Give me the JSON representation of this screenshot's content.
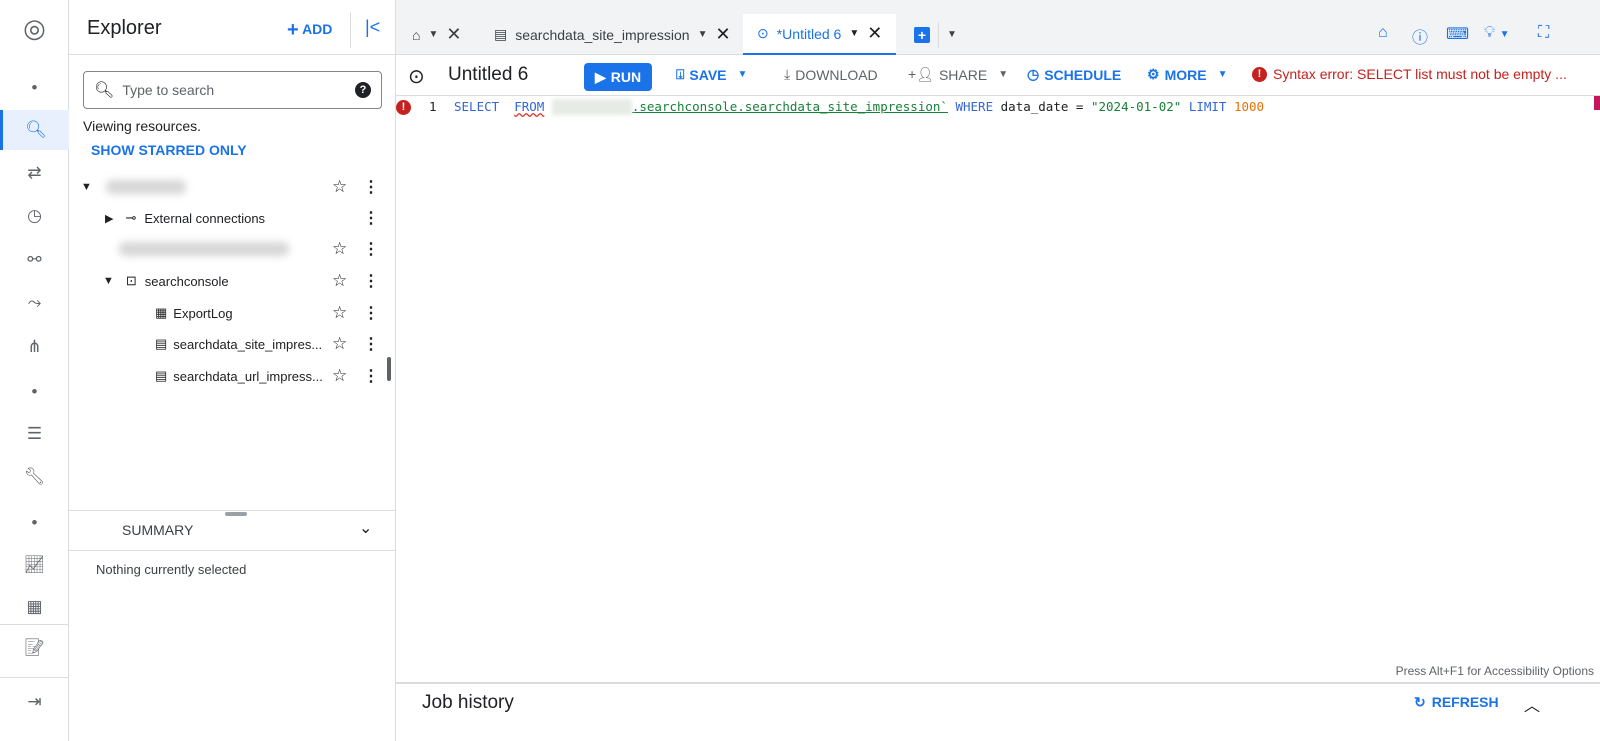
{
  "rail": {
    "items": [
      "dot",
      "search",
      "transfers",
      "scheduled",
      "analytics-hub",
      "dataflow",
      "graph",
      "dot",
      "list",
      "wrench",
      "dot",
      "monitoring",
      "dashboard",
      "release-notes",
      "expand"
    ]
  },
  "explorer": {
    "title": "Explorer",
    "add_label": "ADD",
    "search_placeholder": "Type to search",
    "viewing": "Viewing resources.",
    "show_starred": "SHOW STARRED ONLY",
    "tree": {
      "external": "External connections",
      "dataset": "searchconsole",
      "tables": [
        "ExportLog",
        "searchdata_site_impres...",
        "searchdata_url_impress..."
      ]
    },
    "summary": "SUMMARY",
    "nothing_selected": "Nothing currently selected"
  },
  "tabs": [
    {
      "label": "searchdata_site_impression"
    },
    {
      "label": "*Untitled 6"
    }
  ],
  "toolbar": {
    "title": "Untitled 6",
    "run": "RUN",
    "save": "SAVE",
    "download": "DOWNLOAD",
    "share": "SHARE",
    "schedule": "SCHEDULE",
    "more": "MORE",
    "error": "Syntax error: SELECT list must not be empty ..."
  },
  "editor": {
    "line_number": "1",
    "kw_select": "SELECT",
    "kw_from": "FROM",
    "table": ".searchconsole.searchdata_site_impression`",
    "kw_where": "WHERE",
    "col": "data_date =",
    "date": "\"2024-01-02\"",
    "kw_limit": "LIMIT",
    "limit": "1000",
    "accessibility": "Press Alt+F1 for Accessibility Options"
  },
  "job_history": {
    "title": "Job history",
    "refresh": "REFRESH"
  },
  "colors": {
    "accent": "#1a73e8",
    "error": "#c5221f",
    "string": "#188038",
    "number": "#e8710a"
  }
}
